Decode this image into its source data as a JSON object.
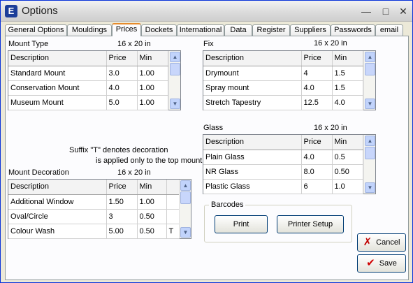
{
  "window": {
    "title": "Options",
    "icon_letter": "E"
  },
  "tabs": [
    {
      "label": "General Options"
    },
    {
      "label": "Mouldings"
    },
    {
      "label": "Prices",
      "active": true
    },
    {
      "label": "Dockets"
    },
    {
      "label": "International"
    },
    {
      "label": "Data"
    },
    {
      "label": "Register"
    },
    {
      "label": "Suppliers"
    },
    {
      "label": "Passwords"
    },
    {
      "label": "email"
    }
  ],
  "mount_type": {
    "title": "Mount Type",
    "size": "16 x 20 in",
    "columns": [
      "Description",
      "Price",
      "Min"
    ],
    "rows": [
      [
        "Standard Mount",
        "3.0",
        "1.00"
      ],
      [
        "Conservation Mount",
        "4.0",
        "1.00"
      ],
      [
        "Museum Mount",
        "5.0",
        "1.00"
      ]
    ]
  },
  "fix": {
    "title": "Fix",
    "size": "16 x 20 in",
    "columns": [
      "Description",
      "Price",
      "Min"
    ],
    "rows": [
      [
        "Drymount",
        "4",
        "1.5"
      ],
      [
        "Spray mount",
        "4.0",
        "1.5"
      ],
      [
        "Stretch Tapestry",
        "12.5",
        "4.0"
      ]
    ]
  },
  "glass": {
    "title": "Glass",
    "size": "16 x 20 in",
    "columns": [
      "Description",
      "Price",
      "Min"
    ],
    "rows": [
      [
        "Plain Glass",
        "4.0",
        "0.5"
      ],
      [
        "NR Glass",
        "8.0",
        "0.50"
      ],
      [
        "Plastic Glass",
        "6",
        "1.0"
      ]
    ]
  },
  "mount_decoration": {
    "title": "Mount Decoration",
    "size": "16 x 20 in",
    "columns": [
      "Description",
      "Price",
      "Min",
      ""
    ],
    "rows": [
      [
        "Additional Window",
        "1.50",
        "1.00",
        ""
      ],
      [
        "Oval/Circle",
        "3",
        "0.50",
        ""
      ],
      [
        "Colour Wash",
        "5.00",
        "0.50",
        "T"
      ]
    ]
  },
  "note": {
    "line1": "Suffix \"T\" denotes decoration",
    "line2": "is applied only to the top mount"
  },
  "barcodes": {
    "title": "Barcodes",
    "print_label": "Print",
    "printer_setup_label": "Printer Setup"
  },
  "actions": {
    "cancel_label": "Cancel",
    "save_label": "Save"
  },
  "colors": {
    "cancel_icon": "#c00000",
    "save_icon": "#d00000",
    "active_tab_accent": "#e68b2c"
  }
}
